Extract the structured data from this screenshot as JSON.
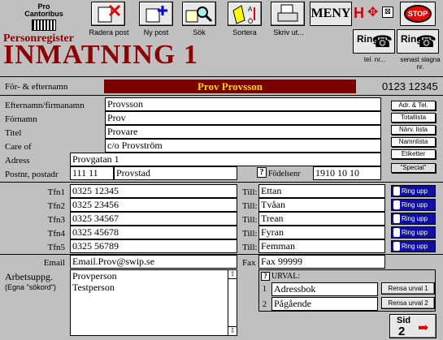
{
  "logo": {
    "line1": "Pro",
    "line2": "Cantoribus"
  },
  "app_title": "Personregister",
  "page_title": "INMATNING 1",
  "toolbar": {
    "radera": "Radera post",
    "nypost": "Ny post",
    "sok": "Sök",
    "sortera": "Sortera",
    "skriv": "Skriv ut...",
    "meny": "MENY",
    "stop": "STOP"
  },
  "ring": {
    "label": "Ring",
    "tel_caption": "tel. nr...",
    "senast_caption": "senast slagna nr."
  },
  "header": {
    "fullname_label": "För- & efternamn",
    "fullname_value": "Prov Provsson",
    "phone_value": "0123 12345"
  },
  "form": {
    "efternamn_label": "Efternamn/firmanamn",
    "efternamn_value": "Provsson",
    "fornamn_label": "Förnamn",
    "fornamn_value": "Prov",
    "titel_label": "Titel",
    "titel_value": "Provare",
    "careof_label": "Care of",
    "careof_value": "c/o Provström",
    "adress_label": "Adress",
    "adress_value": "Provgatan 1",
    "postnr_label": "Postnr, postadr",
    "postnr_value": "111 11",
    "postadr_value": "Provstad",
    "fodelse_label": "Födelsenr",
    "fodelse_value": "1910 10 10"
  },
  "side_buttons": {
    "adr": "Adr. & Tel.",
    "totallista": "Totallista",
    "narv": "Närv. lista",
    "namnlista": "Namnlista",
    "etiketter": "Etiketter",
    "special": "\"Special\""
  },
  "phones": [
    {
      "label": "Tfn1",
      "number": "0325 12345",
      "till_label": "Till:",
      "till": "Ettan",
      "ringup": "Ring upp"
    },
    {
      "label": "Tfn2",
      "number": "0325 23456",
      "till_label": "Till:",
      "till": "Tvåan",
      "ringup": "Ring upp"
    },
    {
      "label": "Tfn3",
      "number": "0325 34567",
      "till_label": "Till:",
      "till": "Trean",
      "ringup": "Ring upp"
    },
    {
      "label": "Tfn4",
      "number": "0325 45678",
      "till_label": "Till:",
      "till": "Fyran",
      "ringup": "Ring upp"
    },
    {
      "label": "Tfn5",
      "number": "0325 56789",
      "till_label": "Till:",
      "till": "Femman",
      "ringup": "Ring upp"
    }
  ],
  "email": {
    "label": "Email",
    "value": "Email.Prov@swip.se"
  },
  "fax": {
    "label": "Fax",
    "value": "Fax 99999"
  },
  "arbetsupp": {
    "label": "Arbetsuppg.",
    "sublabel": "(Egna \"sökord\")",
    "lines": [
      "Provperson",
      "Testperson"
    ]
  },
  "urval": {
    "label": "URVAL:",
    "items": [
      {
        "num": "1",
        "value": "Adressbok",
        "button": "Rensa urval 1"
      },
      {
        "num": "2",
        "value": "Pågående",
        "button": "Rensa urval 2"
      }
    ]
  },
  "sid": {
    "label": "Sid",
    "num": "2"
  },
  "colors": {
    "title_red": "#8b0000",
    "name_bar": "#7a0000",
    "name_text": "#ffd700",
    "ring_blue": "#1010a0"
  }
}
